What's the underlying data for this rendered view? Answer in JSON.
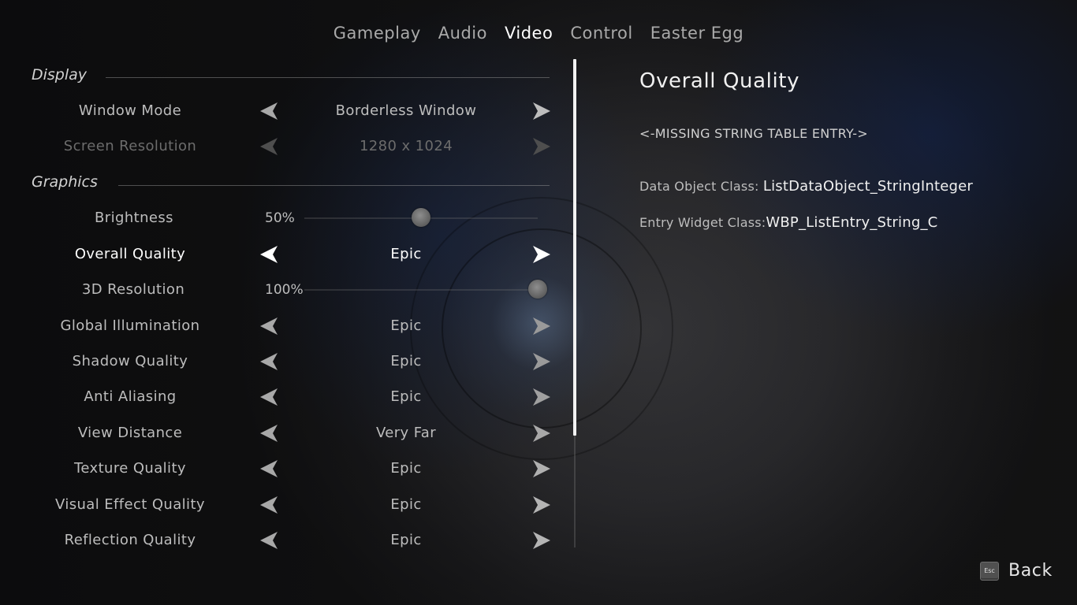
{
  "tabs": [
    {
      "label": "Gameplay",
      "active": false
    },
    {
      "label": "Audio",
      "active": false
    },
    {
      "label": "Video",
      "active": true
    },
    {
      "label": "Control",
      "active": false
    },
    {
      "label": "Easter Egg",
      "active": false
    }
  ],
  "sections": {
    "display": "Display",
    "graphics": "Graphics"
  },
  "settings": {
    "window_mode": {
      "label": "Window Mode",
      "value": "Borderless Window"
    },
    "screen_resolution": {
      "label": "Screen Resolution",
      "value": "1280 x 1024",
      "disabled": true
    },
    "brightness": {
      "label": "Brightness",
      "value": "50%",
      "level": 0.5
    },
    "overall_quality": {
      "label": "Overall Quality",
      "value": "Epic",
      "selected": true
    },
    "resolution_3d": {
      "label": "3D Resolution",
      "value": "100%",
      "level": 1.0
    },
    "global_illumination": {
      "label": "Global Illumination",
      "value": "Epic"
    },
    "shadow_quality": {
      "label": "Shadow Quality",
      "value": "Epic"
    },
    "anti_aliasing": {
      "label": "Anti Aliasing",
      "value": "Epic"
    },
    "view_distance": {
      "label": "View Distance",
      "value": "Very Far"
    },
    "texture_quality": {
      "label": "Texture Quality",
      "value": "Epic"
    },
    "visual_effect_quality": {
      "label": "Visual Effect Quality",
      "value": "Epic"
    },
    "reflection_quality": {
      "label": "Reflection Quality",
      "value": "Epic"
    }
  },
  "detail": {
    "title": "Overall Quality",
    "description": "<-MISSING STRING TABLE ENTRY->",
    "data_object_class_label": "Data Object Class: ",
    "data_object_class_value": "ListDataObject_StringInteger",
    "entry_widget_class_label": "Entry Widget Class:",
    "entry_widget_class_value": "WBP_ListEntry_String_C"
  },
  "footer": {
    "esc_key": "Esc",
    "back_label": "Back"
  },
  "colors": {
    "active_text": "#ffffff",
    "normal_text": "#bdbdbd",
    "disabled_text": "#6c6c6c",
    "scroll_thumb": "#f2f2f2"
  },
  "icons": {
    "arrow_left": "triangle-left-arrow-icon",
    "arrow_right": "triangle-right-arrow-icon",
    "esc": "esc-key-icon"
  }
}
